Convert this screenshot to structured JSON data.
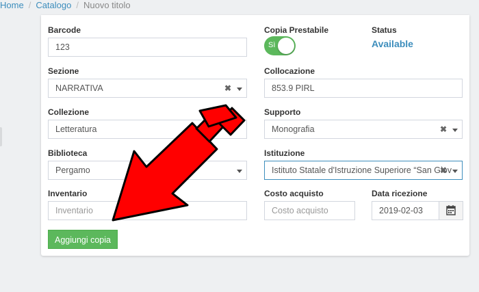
{
  "breadcrumb": {
    "home": "Home",
    "catalog": "Catalogo",
    "current": "Nuovo titolo",
    "separator": "/"
  },
  "form": {
    "barcode": {
      "label": "Barcode",
      "value": "123"
    },
    "copia_prestabile": {
      "label": "Copia Prestabile",
      "toggle_text": "Sì",
      "checked": true
    },
    "status": {
      "label": "Status",
      "value": "Available",
      "color": "#3c8dbc"
    },
    "sezione": {
      "label": "Sezione",
      "value": "NARRATIVA",
      "clear": "✖"
    },
    "collocazione": {
      "label": "Collocazione",
      "value": "853.9 PIRL"
    },
    "collezione": {
      "label": "Collezione",
      "value": "Letteratura"
    },
    "supporto": {
      "label": "Supporto",
      "value": "Monografia",
      "clear": "✖"
    },
    "biblioteca": {
      "label": "Biblioteca",
      "value": "Pergamo"
    },
    "istituzione": {
      "label": "Istituzione",
      "value": "Istituto Statale d'Istruzione Superiore “San Giov",
      "clear": "✖"
    },
    "inventario": {
      "label": "Inventario",
      "placeholder": "Inventario"
    },
    "costo_acquisto": {
      "label": "Costo acquisto",
      "placeholder": "Costo acquisto"
    },
    "data_ricezione": {
      "label": "Data ricezione",
      "value": "2019-02-03"
    },
    "submit": {
      "label": "Aggiungi copia",
      "color": "#5cb85c"
    }
  },
  "overlay": {
    "arrow_color": "#ff0000",
    "icon": "red-arrow-annotation"
  }
}
